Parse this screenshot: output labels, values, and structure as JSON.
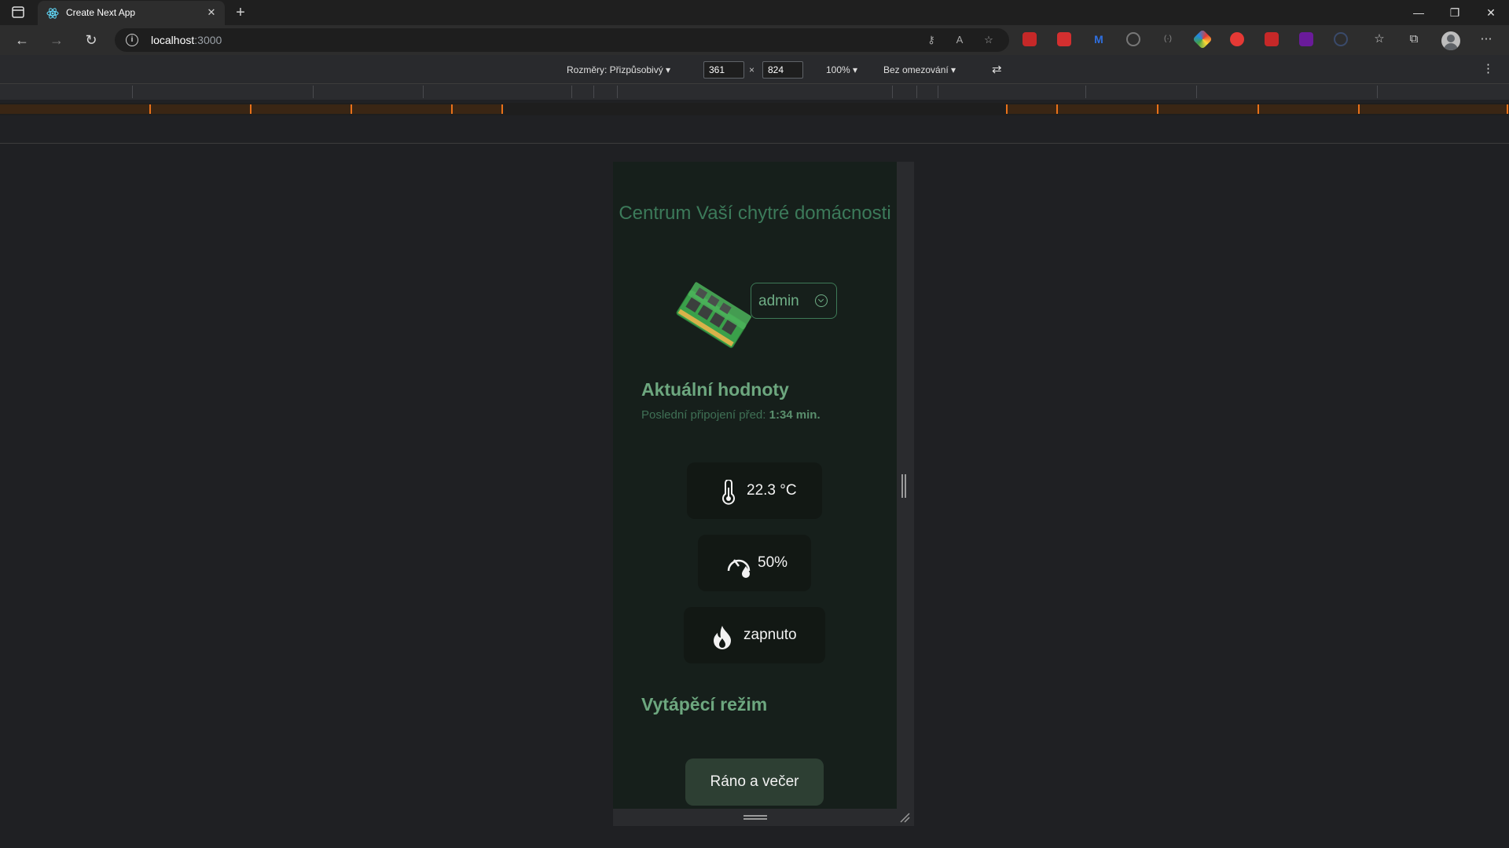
{
  "browser": {
    "tab_title": "Create Next App",
    "url_host": "localhost",
    "url_port": ":3000"
  },
  "devtools": {
    "dimensions_label": "Rozměry: Přizpůsobivý",
    "width": "361",
    "height": "824",
    "times": "×",
    "zoom": "100%",
    "throttling": "Bez omezování"
  },
  "app": {
    "title": "Centrum Vaší chytré domácnosti",
    "user_button": "admin",
    "current_values": {
      "heading": "Aktuální hodnoty",
      "last_connection_prefix": "Poslední připojení před:",
      "last_connection_value": "1:34 min."
    },
    "readings": {
      "temperature": "22.3 °C",
      "humidity": "50%",
      "heating": "zapnuto"
    },
    "heating_mode": {
      "heading": "Vytápěcí režim",
      "button": "Ráno a večer"
    }
  },
  "colors": {
    "accent_green": "#6da77f",
    "page_background": "#161f1b",
    "orange_ruler": "#e8711a"
  }
}
